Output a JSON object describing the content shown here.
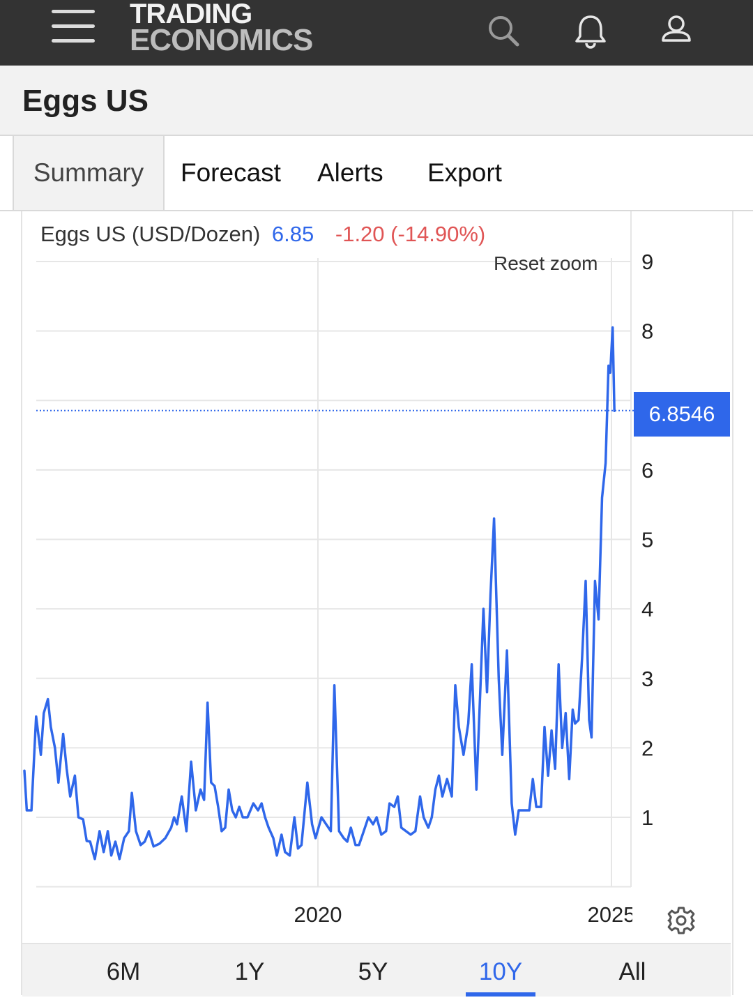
{
  "header": {
    "logo_line1": "TRADING",
    "logo_line2": "ECONOMICS",
    "icons": [
      "menu-icon",
      "search-icon",
      "bell-icon",
      "user-icon"
    ]
  },
  "page": {
    "title": "Eggs US"
  },
  "tabs": [
    {
      "label": "Summary",
      "active": true
    },
    {
      "label": "Forecast"
    },
    {
      "label": "Alerts"
    },
    {
      "label": "Export"
    }
  ],
  "chart_header": {
    "name": "Eggs US (USD/Dozen)",
    "value": "6.85",
    "change": "-1.20 (-14.90%)"
  },
  "reset_zoom": "Reset zoom",
  "price_label": "6.8546",
  "range_buttons": [
    {
      "label": "6M"
    },
    {
      "label": "1Y"
    },
    {
      "label": "5Y"
    },
    {
      "label": "10Y",
      "active": true
    },
    {
      "label": "All"
    }
  ],
  "colors": {
    "line": "#2f67ea",
    "topbar": "#333333",
    "negative": "#e05555"
  },
  "chart_data": {
    "type": "line",
    "title": "Eggs US (USD/Dozen)",
    "y_ticks": [
      "9",
      "8",
      "6",
      "5",
      "4",
      "3",
      "2",
      "1"
    ],
    "x_ticks": [
      "2020",
      "2025"
    ],
    "ylim": [
      0,
      9
    ],
    "xlim": [
      2015.0,
      2025.6
    ],
    "current_value": 6.8546,
    "grid": true,
    "series": [
      {
        "values": [
          [
            2015.0,
            1.67
          ],
          [
            2015.04,
            1.1
          ],
          [
            2015.12,
            1.1
          ],
          [
            2015.2,
            2.45
          ],
          [
            2015.28,
            1.9
          ],
          [
            2015.33,
            2.5
          ],
          [
            2015.4,
            2.7
          ],
          [
            2015.45,
            2.3
          ],
          [
            2015.52,
            2.0
          ],
          [
            2015.58,
            1.5
          ],
          [
            2015.66,
            2.2
          ],
          [
            2015.72,
            1.7
          ],
          [
            2015.78,
            1.3
          ],
          [
            2015.86,
            1.6
          ],
          [
            2015.92,
            1.0
          ],
          [
            2016.0,
            0.97
          ],
          [
            2016.06,
            0.66
          ],
          [
            2016.12,
            0.65
          ],
          [
            2016.2,
            0.4
          ],
          [
            2016.28,
            0.8
          ],
          [
            2016.35,
            0.5
          ],
          [
            2016.42,
            0.8
          ],
          [
            2016.48,
            0.45
          ],
          [
            2016.55,
            0.65
          ],
          [
            2016.62,
            0.4
          ],
          [
            2016.7,
            0.7
          ],
          [
            2016.78,
            0.8
          ],
          [
            2016.83,
            1.35
          ],
          [
            2016.9,
            0.8
          ],
          [
            2016.98,
            0.6
          ],
          [
            2017.05,
            0.65
          ],
          [
            2017.12,
            0.8
          ],
          [
            2017.2,
            0.58
          ],
          [
            2017.3,
            0.62
          ],
          [
            2017.4,
            0.7
          ],
          [
            2017.5,
            0.85
          ],
          [
            2017.55,
            1.0
          ],
          [
            2017.6,
            0.9
          ],
          [
            2017.68,
            1.3
          ],
          [
            2017.76,
            0.8
          ],
          [
            2017.84,
            1.8
          ],
          [
            2017.92,
            1.1
          ],
          [
            2018.0,
            1.4
          ],
          [
            2018.06,
            1.25
          ],
          [
            2018.12,
            2.65
          ],
          [
            2018.18,
            1.5
          ],
          [
            2018.24,
            1.45
          ],
          [
            2018.3,
            1.15
          ],
          [
            2018.36,
            0.8
          ],
          [
            2018.42,
            0.85
          ],
          [
            2018.48,
            1.4
          ],
          [
            2018.54,
            1.1
          ],
          [
            2018.6,
            1.0
          ],
          [
            2018.66,
            1.15
          ],
          [
            2018.72,
            1.0
          ],
          [
            2018.8,
            1.0
          ],
          [
            2018.9,
            1.2
          ],
          [
            2018.98,
            1.1
          ],
          [
            2019.04,
            1.2
          ],
          [
            2019.1,
            1.0
          ],
          [
            2019.16,
            0.85
          ],
          [
            2019.24,
            0.7
          ],
          [
            2019.3,
            0.45
          ],
          [
            2019.38,
            0.75
          ],
          [
            2019.44,
            0.5
          ],
          [
            2019.52,
            0.45
          ],
          [
            2019.6,
            1.0
          ],
          [
            2019.66,
            0.55
          ],
          [
            2019.72,
            0.6
          ],
          [
            2019.82,
            1.5
          ],
          [
            2019.9,
            0.9
          ],
          [
            2019.96,
            0.7
          ],
          [
            2020.06,
            1.0
          ],
          [
            2020.14,
            0.9
          ],
          [
            2020.22,
            0.8
          ],
          [
            2020.28,
            2.9
          ],
          [
            2020.36,
            0.8
          ],
          [
            2020.44,
            0.7
          ],
          [
            2020.5,
            0.65
          ],
          [
            2020.56,
            0.85
          ],
          [
            2020.64,
            0.6
          ],
          [
            2020.7,
            0.6
          ],
          [
            2020.78,
            0.8
          ],
          [
            2020.86,
            1.0
          ],
          [
            2020.94,
            0.9
          ],
          [
            2021.0,
            1.0
          ],
          [
            2021.08,
            0.75
          ],
          [
            2021.16,
            0.8
          ],
          [
            2021.22,
            1.2
          ],
          [
            2021.3,
            1.15
          ],
          [
            2021.36,
            1.3
          ],
          [
            2021.42,
            0.85
          ],
          [
            2021.5,
            0.8
          ],
          [
            2021.58,
            0.75
          ],
          [
            2021.66,
            0.8
          ],
          [
            2021.74,
            1.3
          ],
          [
            2021.8,
            1.0
          ],
          [
            2021.88,
            0.85
          ],
          [
            2021.94,
            1.0
          ],
          [
            2022.0,
            1.4
          ],
          [
            2022.06,
            1.6
          ],
          [
            2022.12,
            1.3
          ],
          [
            2022.2,
            1.55
          ],
          [
            2022.28,
            1.3
          ],
          [
            2022.34,
            2.9
          ],
          [
            2022.4,
            2.3
          ],
          [
            2022.48,
            1.9
          ],
          [
            2022.56,
            2.35
          ],
          [
            2022.62,
            3.2
          ],
          [
            2022.7,
            1.4
          ],
          [
            2022.76,
            2.7
          ],
          [
            2022.82,
            4.0
          ],
          [
            2022.88,
            2.8
          ],
          [
            2022.94,
            4.2
          ],
          [
            2023.0,
            5.3
          ],
          [
            2023.08,
            3.0
          ],
          [
            2023.14,
            1.9
          ],
          [
            2023.22,
            3.4
          ],
          [
            2023.3,
            1.2
          ],
          [
            2023.36,
            0.75
          ],
          [
            2023.42,
            1.1
          ],
          [
            2023.5,
            1.1
          ],
          [
            2023.6,
            1.1
          ],
          [
            2023.66,
            1.55
          ],
          [
            2023.72,
            1.15
          ],
          [
            2023.8,
            1.15
          ],
          [
            2023.86,
            2.3
          ],
          [
            2023.92,
            1.6
          ],
          [
            2023.98,
            2.25
          ],
          [
            2024.04,
            1.7
          ],
          [
            2024.1,
            3.2
          ],
          [
            2024.16,
            2.0
          ],
          [
            2024.22,
            2.5
          ],
          [
            2024.28,
            1.55
          ],
          [
            2024.34,
            2.55
          ],
          [
            2024.38,
            2.35
          ],
          [
            2024.44,
            2.4
          ],
          [
            2024.5,
            3.3
          ],
          [
            2024.56,
            4.4
          ],
          [
            2024.62,
            2.4
          ],
          [
            2024.66,
            2.15
          ],
          [
            2024.72,
            4.4
          ],
          [
            2024.78,
            3.85
          ],
          [
            2024.84,
            5.6
          ],
          [
            2024.9,
            6.1
          ],
          [
            2024.95,
            7.5
          ],
          [
            2024.98,
            7.4
          ],
          [
            2025.02,
            8.05
          ],
          [
            2025.05,
            6.85
          ]
        ]
      }
    ]
  }
}
